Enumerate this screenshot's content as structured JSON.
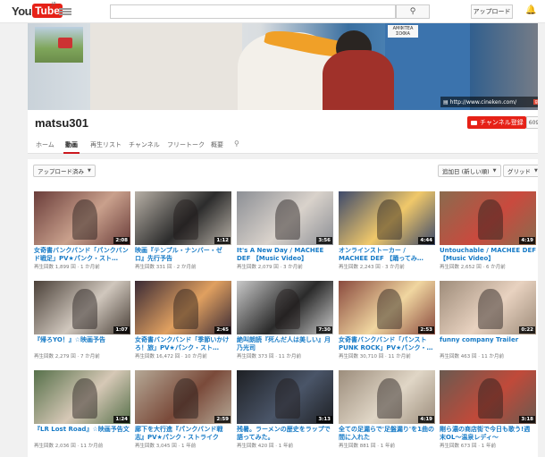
{
  "header": {
    "logo_you": "You",
    "logo_tube": "Tube",
    "logo_region": "JP",
    "upload_label": "アップロード"
  },
  "banner": {
    "sign_text": "ΑΜΦΙΤΕΑ ΣΟΦΙΑ",
    "website": "http://www.cineken.com/",
    "gplus": "g+"
  },
  "channel": {
    "name": "matsu301",
    "subscribe_label": "チャンネル登録",
    "subscriber_count": "609"
  },
  "tabs": [
    {
      "label": "ホーム",
      "active": false
    },
    {
      "label": "動画",
      "active": true
    },
    {
      "label": "再生リスト",
      "active": false
    },
    {
      "label": "チャンネル",
      "active": false
    },
    {
      "label": "フリートーク",
      "active": false
    },
    {
      "label": "概要",
      "active": false
    }
  ],
  "controls": {
    "filter_label": "アップロード済み",
    "sort_label": "追加日 (新しい順)",
    "view_label": "グリッド"
  },
  "videos": [
    {
      "title": "女奇書バンクバンド「パンクバンド戦足」PV★パンク・スト…",
      "duration": "2:08",
      "meta": "再生回数 1,899 回 · 1 か月前"
    },
    {
      "title": "映画『テンプル・ナンバー・ゼロ』先行予告",
      "duration": "1:12",
      "meta": "再生回数 331 回 · 2 か月前"
    },
    {
      "title": "It's A New Day / MACHEE DEF 【Music Video】",
      "duration": "3:56",
      "meta": "再生回数 2,079 回 · 3 か月前"
    },
    {
      "title": "オンラインストーカー / MACHEE DEF 【踊ってみ…",
      "duration": "4:44",
      "meta": "再生回数 2,243 回 · 3 か月前"
    },
    {
      "title": "Untouchable / MACHEE DEF 【Music Video】",
      "duration": "4:19",
      "meta": "再生回数 2,652 回 · 6 か月前"
    },
    {
      "title": "『帰ろYO！』☆映画予告",
      "duration": "1:07",
      "meta": "再生回数 2,279 回 · 7 か月前"
    },
    {
      "title": "女奇書バンクバンド「季節いかけろ！旅」PV★パンク・スト…",
      "duration": "2:45",
      "meta": "再生回数 16,472 回 · 10 か月前"
    },
    {
      "title": "絶叫朗読『死んだ人は美しい』月乃光司",
      "duration": "7:30",
      "meta": "再生回数 373 回 · 11 か月前"
    },
    {
      "title": "女奇書バンクバンド「パンストPUNK ROCK」PV★パンク・…",
      "duration": "2:53",
      "meta": "再生回数 30,710 回 · 11 か月前"
    },
    {
      "title": "funny company Trailer",
      "duration": "0:22",
      "meta": "再生回数 463 回 · 11 か月前"
    },
    {
      "title": "『LR Lost Road』☆映画予告文",
      "duration": "1:24",
      "meta": "再生回数 2,036 回 · 11 か月前"
    },
    {
      "title": "廊下を大行進『パンクバンド戦志』PV★パンク・ストライク",
      "duration": "2:59",
      "meta": "再生回数 3,045 回 · 1 年前"
    },
    {
      "title": "残暑。ラーメンの歴史をラップで語ってみた。",
      "duration": "3:13",
      "meta": "再生回数 420 回 · 1 年前"
    },
    {
      "title": "全ての足漏らで'足盤漏り'を1曲の間に入れた",
      "duration": "4:19",
      "meta": "再生回数 881 回 · 1 年前"
    },
    {
      "title": "剛ら濃の商店街で今日も歌う!週末OL〜温泉レディ〜",
      "duration": "3:18",
      "meta": "再生回数 673 回 · 1 年前"
    }
  ],
  "thumb_colors": [
    "#6a3d3a",
    "#b7b0a6",
    "#8c8f95",
    "#3e4a6b",
    "#8a6b4e",
    "#4a4038",
    "#3a2a35",
    "#c9c9c9",
    "#8a4a3e",
    "#9e8c7a",
    "#56704a",
    "#b5a896",
    "#1e2024",
    "#9c8d7c",
    "#6a5a50"
  ],
  "thumb_accents": [
    "#c9a08c",
    "#2c2c2c",
    "#d9d2cb",
    "#f0c86a",
    "#c94a3e",
    "#d0c7bd",
    "#e0a060",
    "#2a2a2a",
    "#f0d6a0",
    "#e8d2c0",
    "#d6c8b6",
    "#7a4a3a",
    "#4a5568",
    "#e0d6c6",
    "#c04a3a"
  ]
}
